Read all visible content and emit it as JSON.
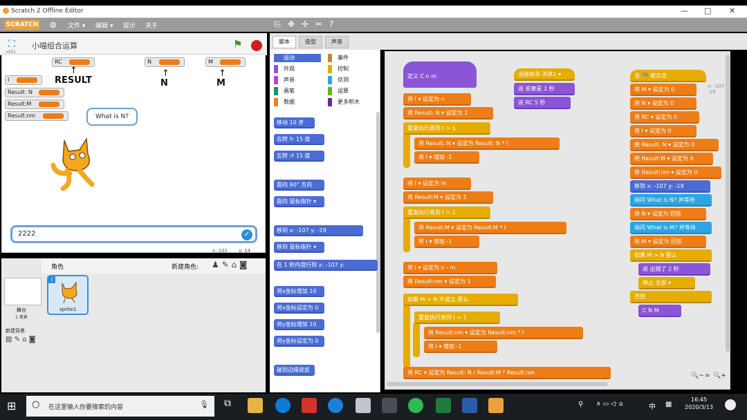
{
  "window": {
    "title": "Scratch 2 Offline Editor",
    "controls": [
      "—",
      "□",
      "✕"
    ]
  },
  "menubar": {
    "logo": "SCRATCH",
    "items": [
      "文件 ▾",
      "编辑 ▾",
      "提示",
      "关于"
    ]
  },
  "stage": {
    "project_title": "小喵组合运算",
    "version": "v451",
    "labels": {
      "result": "RESULT",
      "n": "N",
      "m": "M"
    },
    "monitors": [
      "RC",
      "N",
      "M",
      "I",
      "Result: N",
      "Result:M",
      "Result:nm"
    ],
    "bubble": "What is N?",
    "answer": "2222",
    "coords": {
      "x": "x: 101",
      "y": "y: 14"
    }
  },
  "sprites": {
    "header": "角色",
    "new_sprite": "新建角色:",
    "stage_label": "舞台",
    "stage_count": "1 背景",
    "new_backdrop": "新建背景",
    "sprite_name": "sprite1"
  },
  "tabs": [
    "脚本",
    "造型",
    "声音"
  ],
  "categories": [
    {
      "label": "运动",
      "color": "#4a6cd4"
    },
    {
      "label": "外观",
      "color": "#8a55d7"
    },
    {
      "label": "声音",
      "color": "#bb42c3"
    },
    {
      "label": "画笔",
      "color": "#0e9a6c"
    },
    {
      "label": "数据",
      "color": "#ee7d16"
    },
    {
      "label": "事件",
      "color": "#c88330"
    },
    {
      "label": "控制",
      "color": "#e6ac00"
    },
    {
      "label": "侦测",
      "color": "#2ca5e2"
    },
    {
      "label": "运算",
      "color": "#5cb712"
    },
    {
      "label": "更多积木",
      "color": "#632d99"
    }
  ],
  "palette": [
    "移动 10 步",
    "右转 ↻ 15 度",
    "左转 ↺ 15 度",
    "面向 90° 方向",
    "面向 鼠标指针 ▾",
    "移到 x: -107 y: -19",
    "移到 鼠标指针 ▾",
    "在 1 秒内滑行到 x: -107 y:",
    "将x坐标增加 10",
    "将x坐标设定为 0",
    "将y坐标增加 10",
    "将y坐标设定为 0",
    "碰到边缘就反弹"
  ],
  "scripts": {
    "define": "定义 C n m",
    "col1": [
      "将 I ▾ 设定为 n",
      "将 Result: N ▾ 设定为 1",
      "重复执行直到 I = 1",
      "将 Result: N ▾ 设定为 Result: N * I",
      "将 I ▾ 增加 -1",
      "将 I ▾ 设定为 m",
      "将 Result:M ▾ 设定为 1",
      "重复执行直到 I = 1",
      "将 Result:M ▾ 设定为 Result:M * I",
      "将 I ▾ 增加 -1",
      "将 I ▾ 设定为 n - m",
      "将 Result:nm ▾ 设定为 1",
      "如果 M = N 不成立 那么",
      "重复执行直到 I = 1",
      "将 Result:nm ▾ 设定为 Result:nm * I",
      "将 I ▾ 增加 -1",
      "将 RC ▾ 设定为 Result: N / Result:M * Result:nm"
    ],
    "col2_hat": "当接收到 消息1 ▾",
    "col2": [
      "说 答案是 2 秒",
      "说 RC 5 秒"
    ],
    "col3_hat": "当 🏁 被点击",
    "col3": [
      "将 M ▾ 设定为 0",
      "将 N ▾ 设定为 0",
      "将 RC ▾ 设定为 0",
      "将 I ▾ 设定为 0",
      "将 Result: N ▾ 设定为 0",
      "将 Result:M ▾ 设定为 0",
      "将 Result:nm ▾ 设定为 0",
      "移到 x: -107 y: -19",
      "询问 What is N? 并等待",
      "将 N ▾ 设定为 回答",
      "询问 What is M? 并等待",
      "将 M ▾ 设定为 回答",
      "如果 M > N 那么",
      "说 出错了 2 秒",
      "停止 全部 ▾",
      "否则",
      "C N M"
    ],
    "sprite_xy": "x: -107 y: -19"
  },
  "zoom": [
    "🔍−",
    "=",
    "🔍+"
  ],
  "taskbar": {
    "search_placeholder": "在这里输入你要搜索的内容",
    "time": "16:45",
    "date": "2020/3/13",
    "tray": "中"
  }
}
